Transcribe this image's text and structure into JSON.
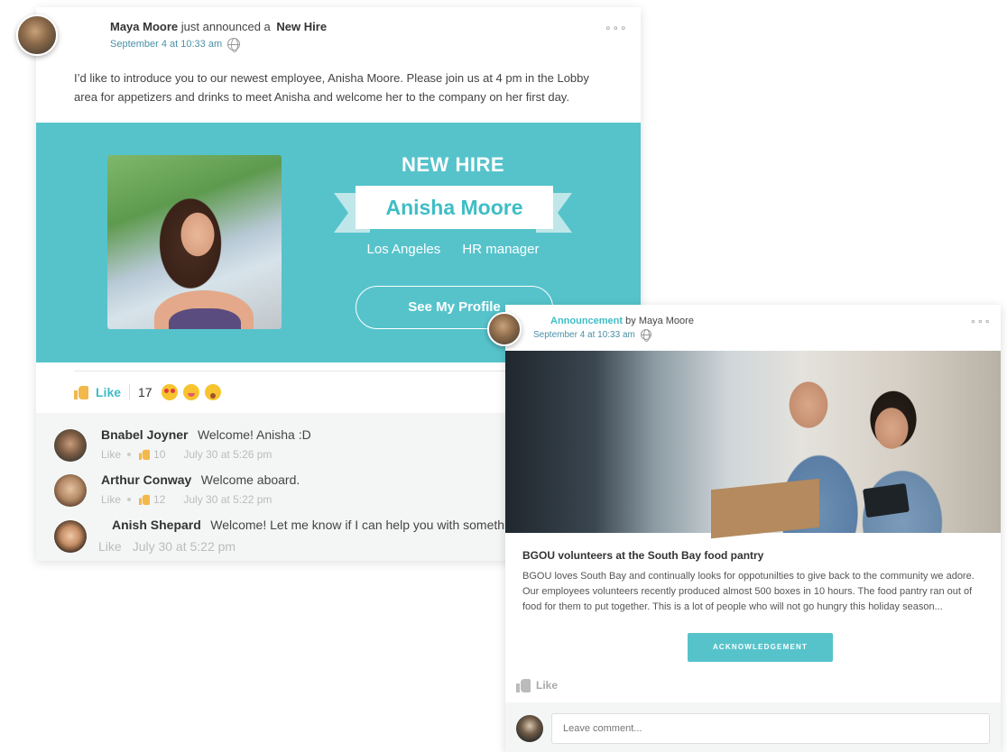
{
  "post1": {
    "author": "Maya Moore",
    "action": "just announced a",
    "type": "New Hire",
    "date": "September 4 at 10:33 am",
    "menu": "∘∘∘",
    "body": "I’d like to introduce you to our newest employee, Anisha Moore. Please join us at 4 pm in the Lobby area for appetizers and drinks to meet Anisha and welcome her to the company on her first day.",
    "banner": {
      "heading": "NEW HIRE",
      "name": "Anisha Moore",
      "location": "Los Angeles",
      "role": "HR manager",
      "button": "See My Profile"
    },
    "like_label": "Like",
    "reaction_count": "17",
    "comments": [
      {
        "name": "Bnabel Joyner",
        "text": "Welcome! Anisha :D",
        "like": "Like",
        "likes": "10",
        "time": "July 30 at 5:26 pm"
      },
      {
        "name": "Arthur Conway",
        "text": "Welcome aboard.",
        "like": "Like",
        "likes": "12",
        "time": "July 30 at 5:22 pm"
      },
      {
        "name": "Anish Shepard",
        "text": "Welcome! Let me know if I can help you with something.",
        "like": "Like",
        "time": "July 30 at 5:22 pm"
      }
    ]
  },
  "post2": {
    "category": "Announcement",
    "by": "by",
    "author": "Maya Moore",
    "date": "September 4 at 10:33 am",
    "menu": "∘∘∘",
    "title": "BGOU volunteers at the South Bay food pantry",
    "body": "BGOU loves South Bay and continually looks for oppotunilties  to give back to the community we adore. Our employees volunteers recently produced almost 500 boxes in 10 hours. The food pantry ran out of food for them to put together. This is a lot of people who will not go hungry this holiday season...",
    "button": "ACKNOWLEDGEMENT",
    "like_label": "Like",
    "comment_placeholder": "Leave comment..."
  },
  "colors": {
    "accent": "#56c3cb",
    "accent_text": "#3fbdc6",
    "like_thumb": "#f2b84b"
  },
  "icons": [
    "globe-icon",
    "more-icon",
    "thumbs-up-icon",
    "heart-eyes-emoji",
    "yum-emoji",
    "wow-emoji"
  ]
}
